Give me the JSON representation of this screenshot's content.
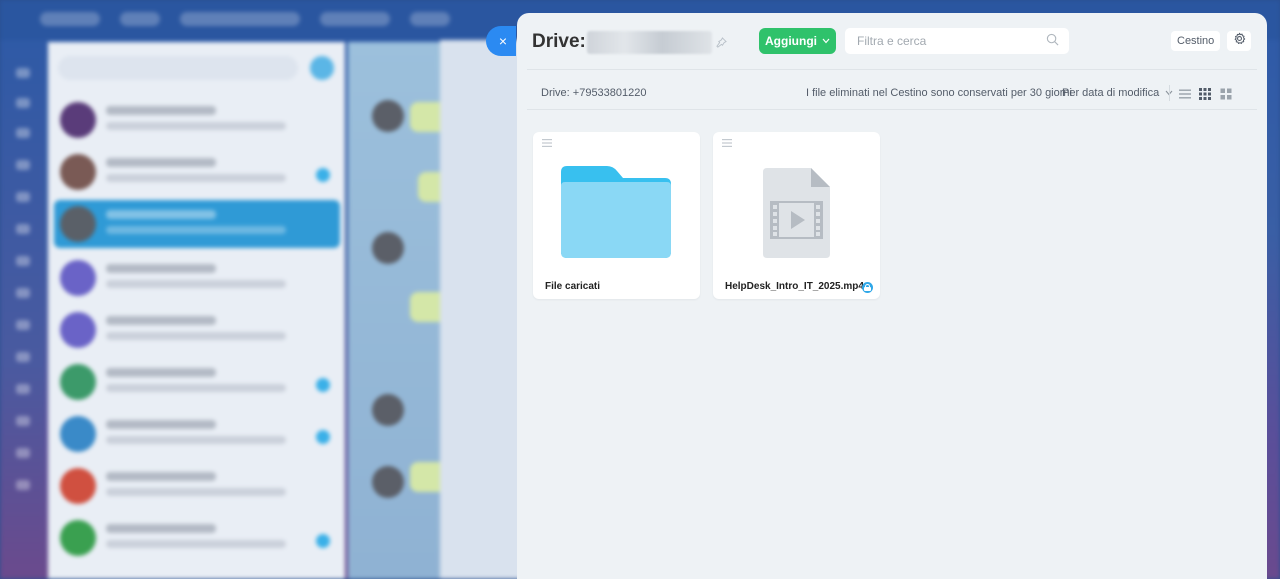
{
  "drive": {
    "title": "Drive:",
    "close_icon": "×",
    "pin_icon": "pin-icon",
    "add_label": "Aggiungi",
    "filter_placeholder": "Filtra e cerca",
    "trash_label": "Cestino",
    "drive_id": "Drive: +79533801220",
    "retention_note": "I file eliminati nel Cestino sono conservati per 30 giorni",
    "sort_label": "Per data di modifica",
    "view_modes": [
      "list-view-icon",
      "grid-view-icon",
      "large-grid-view-icon"
    ],
    "items": [
      {
        "type": "folder",
        "name": "File caricati",
        "icon": "folder-icon"
      },
      {
        "type": "file",
        "name": "HelpDesk_Intro_IT_2025.mp4",
        "icon": "video-file-icon",
        "shared": true
      }
    ]
  },
  "colors": {
    "accent_green": "#2fc26b",
    "close_blue": "#2b8af2",
    "folder_blue": "#8ad8f5",
    "folder_tab": "#38c0ef"
  }
}
